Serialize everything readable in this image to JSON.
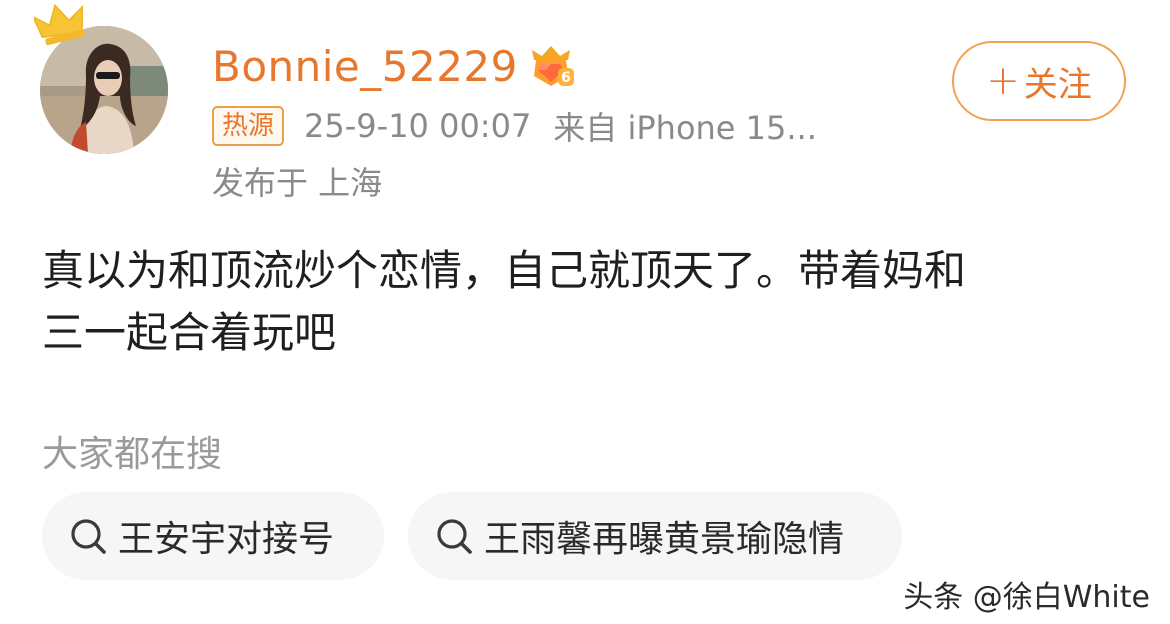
{
  "post": {
    "author": {
      "username": "Bonnie_52229",
      "avatar_icon": "avatar-photo",
      "crown_icon": "crown-icon",
      "vip_icon": "vip-level-6-icon"
    },
    "meta": {
      "hot_badge": "热源",
      "time": "25-9-10 00:07",
      "source": "来自 iPhone 15...",
      "location": "发布于 上海"
    },
    "follow_button": {
      "plus": "+",
      "label": "关注"
    },
    "content_lines": [
      "真以为和顶流炒个恋情，自己就顶天了。带着妈和",
      "三一起合着玩吧"
    ]
  },
  "search_section": {
    "title": "大家都在搜",
    "items": [
      {
        "label": "王安宇对接号",
        "icon": "search-icon"
      },
      {
        "label": "王雨馨再曝黄景瑜隐情",
        "icon": "search-icon"
      }
    ]
  },
  "watermark": "头条 @徐白White",
  "colors": {
    "accent_orange": "#e8772e",
    "meta_gray": "#8a8a8a",
    "chip_bg": "#f6f6f6",
    "text_dark": "#1f1f1f"
  }
}
